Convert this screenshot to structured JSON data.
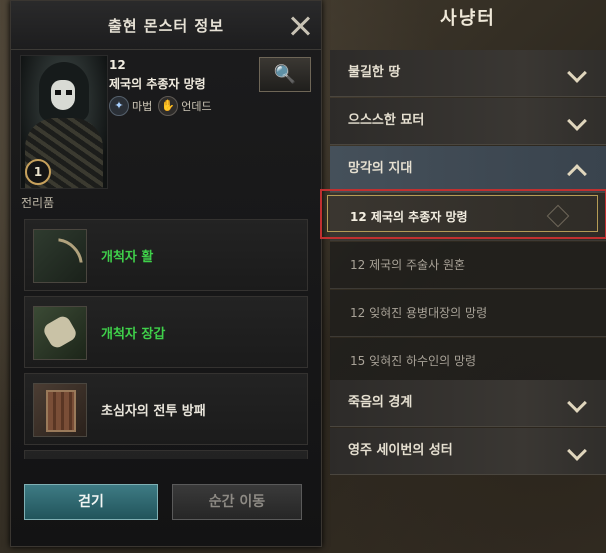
{
  "panel": {
    "title": "출현 몬스터 정보",
    "monster": {
      "level": "12",
      "name": "제국의 추종자 망령",
      "badge": "1",
      "tags": [
        {
          "icon": "magic-icon",
          "label": "마법"
        },
        {
          "icon": "undead-hand-icon",
          "label": "언데드"
        }
      ]
    },
    "loot_label": "전리품",
    "loot": [
      {
        "name": "개척자 활",
        "icon": "bow-icon",
        "color": "#3fcf4a"
      },
      {
        "name": "개척자 장갑",
        "icon": "glove-icon",
        "color": "#3fcf4a"
      },
      {
        "name": "초심자의 전투 방패",
        "icon": "shield-icon",
        "color": "#eae6dc"
      }
    ],
    "buttons": {
      "walk": "걷기",
      "teleport": "순간 이동"
    }
  },
  "hunting": {
    "title": "사냥터",
    "categories": [
      {
        "label": "불길한 땅"
      },
      {
        "label": "으스스한 묘터"
      },
      {
        "label": "망각의 지대"
      },
      {
        "label": "죽음의 경계"
      },
      {
        "label": "영주 세이번의 성터"
      }
    ],
    "sub_items": [
      {
        "label": "12 제국의 추종자 망령"
      },
      {
        "label": "12 제국의 주술사 원혼"
      },
      {
        "label": "12 잊혀진 용병대장의 망령"
      },
      {
        "label": "15 잊혀진 하수인의 망령"
      }
    ]
  }
}
